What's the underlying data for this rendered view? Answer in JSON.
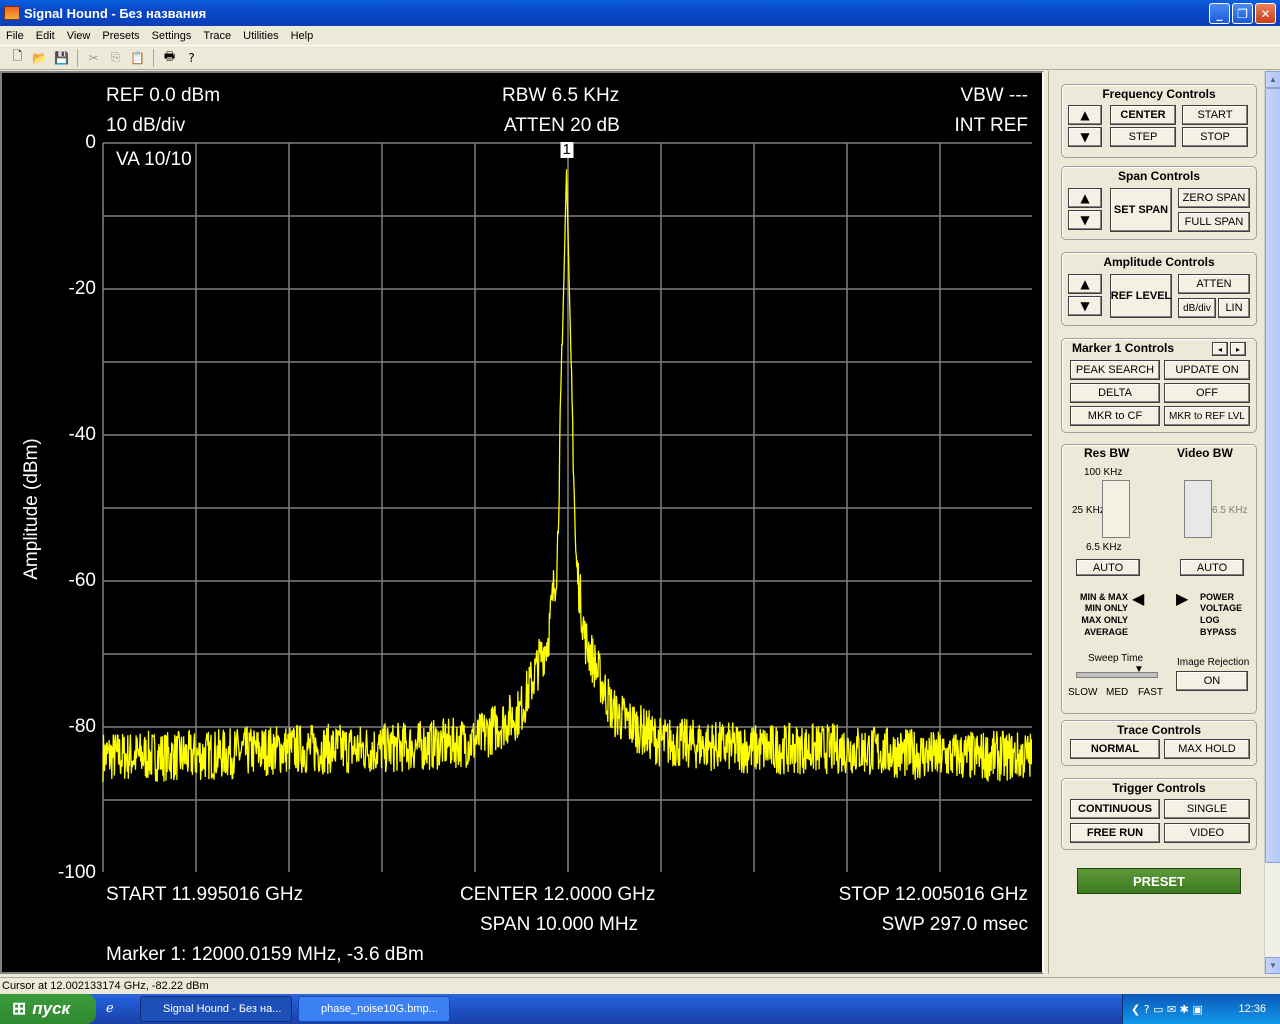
{
  "window": {
    "title": "Signal Hound - Без названия"
  },
  "menu": [
    "File",
    "Edit",
    "View",
    "Presets",
    "Settings",
    "Trace",
    "Utilities",
    "Help"
  ],
  "plot": {
    "ref": "REF 0.0 dBm",
    "scale": "10 dB/div",
    "rbw": "RBW 6.5 KHz",
    "atten": "ATTEN 20 dB",
    "vbw": "VBW ---",
    "intref": "INT REF",
    "va": "VA 10/10",
    "marker_flag": "1",
    "start": "START 11.995016 GHz",
    "center": "CENTER 12.0000 GHz",
    "stop": "STOP 12.005016 GHz",
    "span": "SPAN 10.000 MHz",
    "swp": "SWP 297.0 msec",
    "marker_readout": "Marker 1: 12000.0159 MHz, -3.6 dBm",
    "ylabel": "Amplitude (dBm)",
    "yticks": [
      "0",
      "-20",
      "-40",
      "-60",
      "-80",
      "-100"
    ],
    "trace_color": "#ffff00"
  },
  "chart_data": {
    "type": "line",
    "xlabel": "",
    "ylabel": "Amplitude (dBm)",
    "ylim": [
      -100,
      0
    ],
    "xlim_ghz": [
      11.995016,
      12.005016
    ],
    "grid": true,
    "series": [
      {
        "x_ghz": [
          11.995016,
          11.996,
          11.997,
          11.998,
          11.999,
          11.9995,
          11.9998,
          11.9999,
          12.0,
          12.0001,
          12.0002,
          12.0005,
          12.001,
          12.002,
          12.003,
          12.004,
          12.005016
        ],
        "y_dbm": [
          -84,
          -84,
          -83,
          -83,
          -82,
          -78,
          -68,
          -57,
          -3.6,
          -57,
          -68,
          -78,
          -82,
          -83,
          -83,
          -84,
          -84
        ]
      }
    ]
  },
  "panel": {
    "freq": {
      "title": "Frequency Controls",
      "center": "CENTER",
      "start": "START",
      "step": "STEP",
      "stop": "STOP"
    },
    "span": {
      "title": "Span Controls",
      "set": "SET SPAN",
      "zero": "ZERO SPAN",
      "full": "FULL SPAN"
    },
    "amp": {
      "title": "Amplitude Controls",
      "ref": "REF LEVEL",
      "atten": "ATTEN",
      "dbdiv": "dB/div",
      "lin": "LIN"
    },
    "marker": {
      "title": "Marker 1 Controls",
      "peak": "PEAK SEARCH",
      "update": "UPDATE ON",
      "delta": "DELTA",
      "off": "OFF",
      "cf": "MKR to CF",
      "ref": "MKR to REF LVL"
    },
    "bw": {
      "res": "Res BW",
      "video": "Video BW",
      "r100": "100 KHz",
      "r25": "25 KHz",
      "r65": "6.5 KHz",
      "v65": "6.5 KHz",
      "auto": "AUTO",
      "auto2": "AUTO"
    },
    "detector": [
      "MIN & MAX",
      "MIN ONLY",
      "MAX ONLY",
      "AVERAGE"
    ],
    "scale": [
      "POWER",
      "VOLTAGE",
      "LOG",
      "BYPASS"
    ],
    "sweep": {
      "title": "Sweep Time",
      "slow": "SLOW",
      "med": "MED",
      "fast": "FAST"
    },
    "image": {
      "title": "Image Rejection",
      "on": "ON"
    },
    "trace": {
      "title": "Trace Controls",
      "normal": "NORMAL",
      "maxhold": "MAX HOLD"
    },
    "trigger": {
      "title": "Trigger Controls",
      "cont": "CONTINUOUS",
      "single": "SINGLE",
      "free": "FREE RUN",
      "video": "VIDEO"
    },
    "preset": "PRESET"
  },
  "status": "Cursor at 12.002133174 GHz, -82.22 dBm",
  "taskbar": {
    "start": "пуск",
    "task1": "Signal Hound - Без на...",
    "task2": "phase_noise10G.bmp...",
    "clock": "12:36"
  }
}
